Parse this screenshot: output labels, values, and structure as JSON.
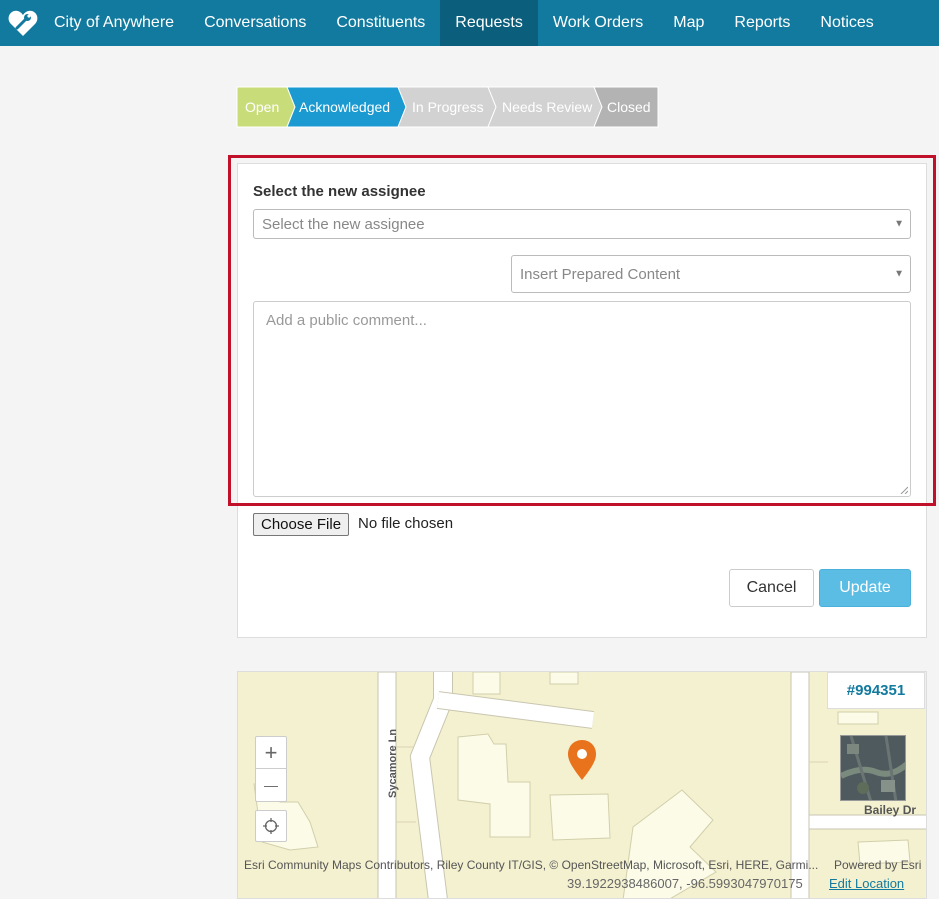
{
  "nav": {
    "brand": "City of Anywhere",
    "items": [
      {
        "label": "Conversations"
      },
      {
        "label": "Constituents"
      },
      {
        "label": "Requests",
        "active": true
      },
      {
        "label": "Work Orders"
      },
      {
        "label": "Map"
      },
      {
        "label": "Reports"
      },
      {
        "label": "Notices"
      }
    ]
  },
  "status_steps": [
    {
      "label": "Open",
      "color": "#c8dd7a"
    },
    {
      "label": "Acknowledged",
      "color": "#1a9ad0",
      "current": true
    },
    {
      "label": "In Progress",
      "color": "#d2d2d2"
    },
    {
      "label": "Needs Review",
      "color": "#d2d2d2"
    },
    {
      "label": "Closed",
      "color": "#b3b3b3"
    }
  ],
  "form": {
    "assignee_label": "Select the new assignee",
    "assignee_placeholder": "Select the new assignee",
    "prepared_content_placeholder": "Insert Prepared Content",
    "comment_placeholder": "Add a public comment...",
    "file_button": "Choose File",
    "file_status": "No file chosen",
    "cancel_label": "Cancel",
    "update_label": "Update"
  },
  "map": {
    "request_id": "#994351",
    "streets": {
      "vertical": "Sycamore Ln",
      "horizontal": "Bailey Dr"
    },
    "attribution": "Esri Community Maps Contributors, Riley County IT/GIS, © OpenStreetMap, Microsoft, Esri, HERE, Garmi...",
    "powered_by": "Powered by Esri",
    "coordinates": "39.1922938486007, -96.5993047970175",
    "edit_location": "Edit Location",
    "zoom_in": "+",
    "zoom_out": "—",
    "marker_color": "#e8731c"
  },
  "colors": {
    "nav_bg": "#117a9e",
    "nav_active": "#0b5f7c",
    "highlight": "#c0102a",
    "update_button": "#5bbde4"
  }
}
